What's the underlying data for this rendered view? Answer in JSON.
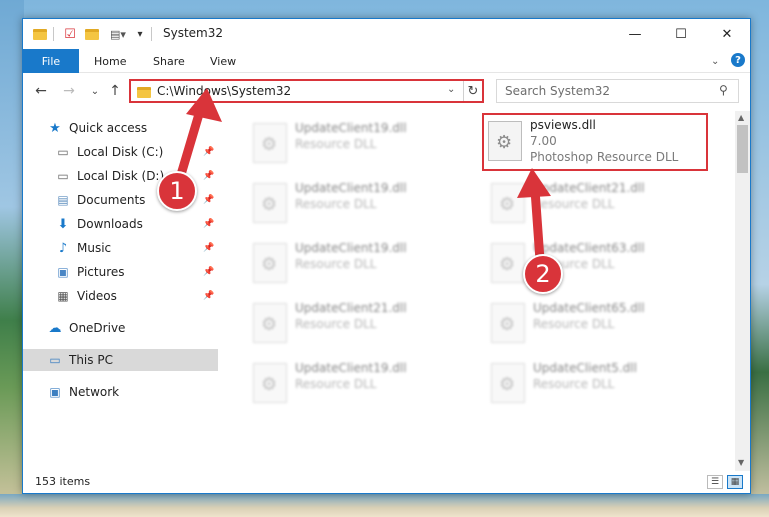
{
  "window": {
    "title": "System32",
    "controls": {
      "minimize": "—",
      "maximize": "☐",
      "close": "✕"
    }
  },
  "ribbon": {
    "tabs": [
      {
        "label": "File",
        "active": true
      },
      {
        "label": "Home"
      },
      {
        "label": "Share"
      },
      {
        "label": "View"
      }
    ],
    "help": "?"
  },
  "navigation": {
    "address": "C:\\Windows\\System32",
    "search_placeholder": "Search System32"
  },
  "sidebar": {
    "items": [
      {
        "label": "Quick access",
        "icon": "star-icon"
      },
      {
        "label": "Local Disk (C:)",
        "icon": "drive-icon",
        "pinned": true
      },
      {
        "label": "Local Disk (D:)",
        "icon": "drive-icon",
        "pinned": true
      },
      {
        "label": "Documents",
        "icon": "documents-icon",
        "pinned": true
      },
      {
        "label": "Downloads",
        "icon": "download-arrow-icon",
        "pinned": true
      },
      {
        "label": "Music",
        "icon": "music-note-icon",
        "pinned": true
      },
      {
        "label": "Pictures",
        "icon": "pictures-icon",
        "pinned": true
      },
      {
        "label": "Videos",
        "icon": "videos-icon",
        "pinned": true
      },
      {
        "label": "OneDrive",
        "icon": "cloud-icon"
      },
      {
        "label": "This PC",
        "icon": "monitor-icon",
        "selected": true
      },
      {
        "label": "Network",
        "icon": "network-icon"
      }
    ]
  },
  "files": {
    "highlighted": {
      "name": "psviews.dll",
      "version": "7.00",
      "description": "Photoshop Resource DLL"
    },
    "left_column": [
      {
        "name": "UpdateClient19.dll",
        "type": "Resource DLL"
      },
      {
        "name": "UpdateClient19.dll",
        "type": "Resource DLL"
      },
      {
        "name": "UpdateClient19.dll",
        "type": "Resource DLL"
      },
      {
        "name": "UpdateClient21.dll",
        "type": "Resource DLL"
      },
      {
        "name": "UpdateClient19.dll",
        "type": "Resource DLL"
      }
    ],
    "right_column": [
      {
        "name": "UpdateClient21.dll",
        "type": "Resource DLL"
      },
      {
        "name": "UpdateClient63.dll",
        "type": "Resource DLL"
      },
      {
        "name": "UpdateClient65.dll",
        "type": "Resource DLL"
      },
      {
        "name": "UpdateClient5.dll",
        "type": "Resource DLL"
      }
    ]
  },
  "status": {
    "item_count": "153 items"
  },
  "annotations": {
    "step1": "1",
    "step2": "2",
    "color": "#d9343a"
  }
}
